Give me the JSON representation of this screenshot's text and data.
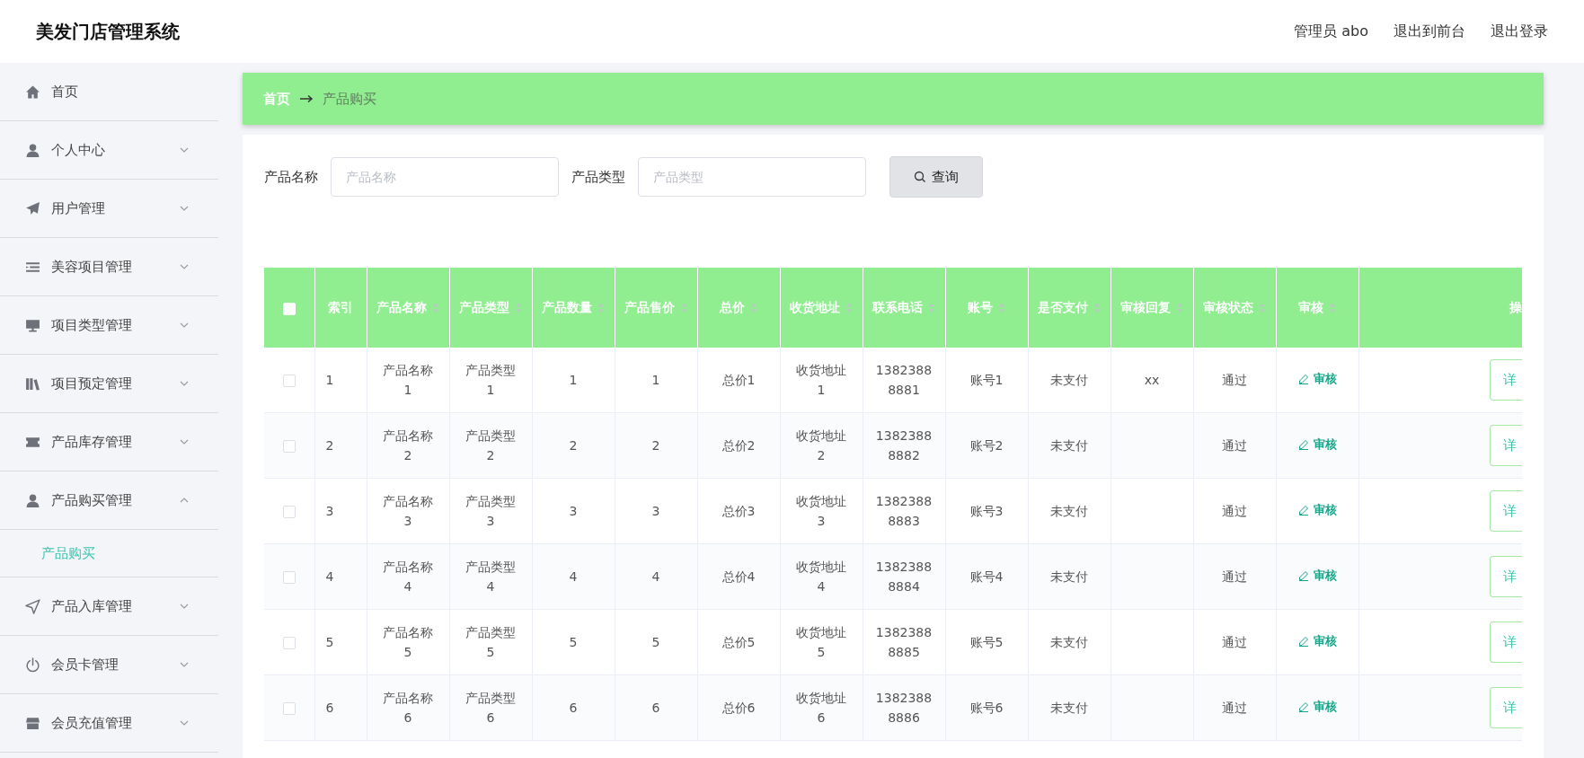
{
  "app_title": "美发门店管理系统",
  "top_links": [
    "管理员 abo",
    "退出到前台",
    "退出登录"
  ],
  "sidebar": {
    "items": [
      {
        "label": "首页",
        "kind": "link"
      },
      {
        "label": "个人中心",
        "kind": "menu",
        "expanded": false
      },
      {
        "label": "用户管理",
        "kind": "menu",
        "expanded": false
      },
      {
        "label": "美容项目管理",
        "kind": "menu",
        "expanded": false
      },
      {
        "label": "项目类型管理",
        "kind": "menu",
        "expanded": false
      },
      {
        "label": "项目预定管理",
        "kind": "menu",
        "expanded": false
      },
      {
        "label": "产品库存管理",
        "kind": "menu",
        "expanded": false
      },
      {
        "label": "产品购买管理",
        "kind": "menu",
        "expanded": true,
        "children": [
          {
            "label": "产品购买",
            "selected": true
          }
        ]
      },
      {
        "label": "产品入库管理",
        "kind": "menu",
        "expanded": false
      },
      {
        "label": "会员卡管理",
        "kind": "menu",
        "expanded": false
      },
      {
        "label": "会员充值管理",
        "kind": "menu",
        "expanded": false
      }
    ]
  },
  "breadcrumb": [
    "首页",
    "产品购买"
  ],
  "search": {
    "fields": [
      {
        "label": "产品名称",
        "placeholder": "产品名称"
      },
      {
        "label": "产品类型",
        "placeholder": "产品类型"
      }
    ],
    "button": "查询"
  },
  "table": {
    "select_all_checked": false,
    "columns": [
      {
        "label": "索引",
        "sortable": false
      },
      {
        "label": "产品名称",
        "sortable": true
      },
      {
        "label": "产品类型",
        "sortable": true
      },
      {
        "label": "产品数量",
        "sortable": true
      },
      {
        "label": "产品售价",
        "sortable": true
      },
      {
        "label": "总价",
        "sortable": true
      },
      {
        "label": "收货地址",
        "sortable": true
      },
      {
        "label": "联系电话",
        "sortable": true
      },
      {
        "label": "账号",
        "sortable": true
      },
      {
        "label": "是否支付",
        "sortable": true
      },
      {
        "label": "审核回复",
        "sortable": true
      },
      {
        "label": "审核状态",
        "sortable": true
      },
      {
        "label": "审核",
        "sortable": true
      },
      {
        "label": "操",
        "sortable": false
      }
    ],
    "rows": [
      {
        "checked": false,
        "cells": [
          "1",
          "产品名称1",
          "产品类型1",
          "1",
          "1",
          "总价1",
          "收货地址1",
          "13823888881",
          "账号1",
          "未支付",
          "xx",
          "通过"
        ],
        "review": "审核",
        "action": "详"
      },
      {
        "checked": false,
        "cells": [
          "2",
          "产品名称2",
          "产品类型2",
          "2",
          "2",
          "总价2",
          "收货地址2",
          "13823888882",
          "账号2",
          "未支付",
          null,
          "通过"
        ],
        "review": "审核",
        "action": "详"
      },
      {
        "checked": false,
        "cells": [
          "3",
          "产品名称3",
          "产品类型3",
          "3",
          "3",
          "总价3",
          "收货地址3",
          "13823888883",
          "账号3",
          "未支付",
          null,
          "通过"
        ],
        "review": "审核",
        "action": "详"
      },
      {
        "checked": false,
        "cells": [
          "4",
          "产品名称4",
          "产品类型4",
          "4",
          "4",
          "总价4",
          "收货地址4",
          "13823888884",
          "账号4",
          "未支付",
          null,
          "通过"
        ],
        "review": "审核",
        "action": "详"
      },
      {
        "checked": false,
        "cells": [
          "5",
          "产品名称5",
          "产品类型5",
          "5",
          "5",
          "总价5",
          "收货地址5",
          "13823888885",
          "账号5",
          "未支付",
          null,
          "通过"
        ],
        "review": "审核",
        "action": "详"
      },
      {
        "checked": false,
        "cells": [
          "6",
          "产品名称6",
          "产品类型6",
          "6",
          "6",
          "总价6",
          "收货地址6",
          "13823888886",
          "账号6",
          "未支付",
          null,
          "通过"
        ],
        "review": "审核",
        "action": "详"
      }
    ]
  }
}
